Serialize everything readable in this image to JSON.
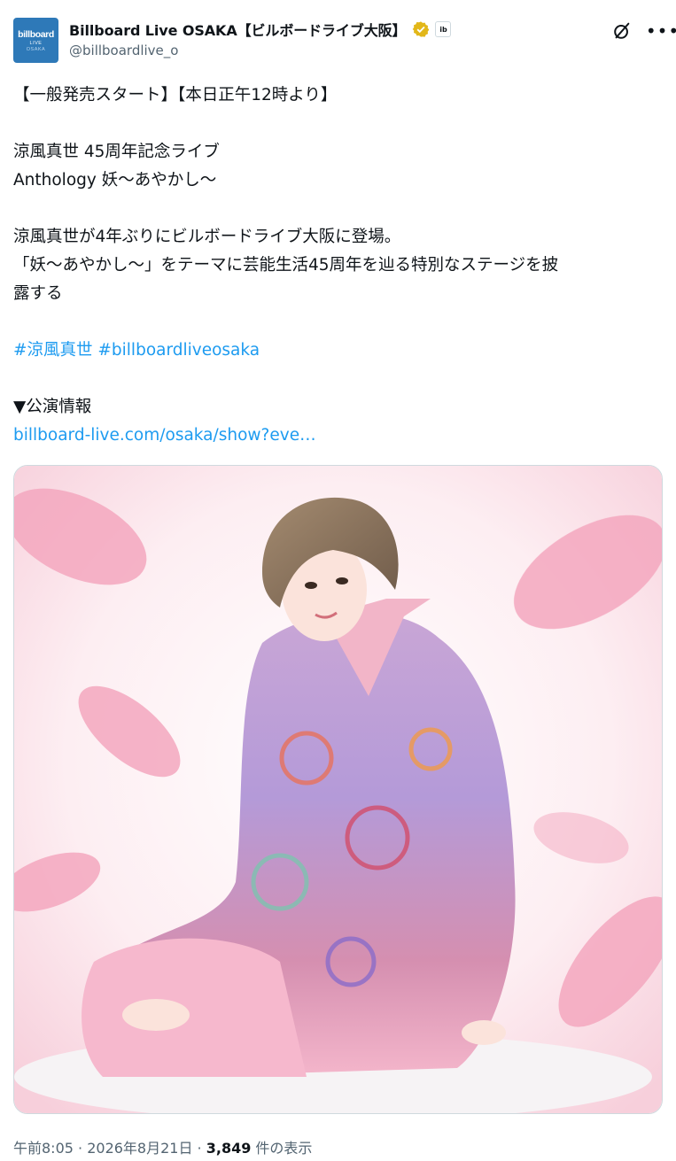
{
  "account": {
    "avatar_logo_top": "billboard",
    "avatar_logo_mid": "LIVE",
    "avatar_logo_bottom": "OSAKA",
    "display_name": "Billboard Live OSAKA【ビルボードライブ大阪】",
    "affiliate_badge": "ib",
    "handle": "@billboardlive_o"
  },
  "toolbar": {
    "grok_icon": "grok-icon",
    "more_icon": "more-options-icon"
  },
  "tweet": {
    "line1": "【一般発売スタート】【本日正午12時より】",
    "line2": "涼風真世 45周年記念ライブ",
    "line3": "Anthology 妖〜あやかし〜",
    "line4": "涼風真世が4年ぶりにビルボードライブ大阪に登場。",
    "line5": "「妖〜あやかし〜」をテーマに芸能生活45周年を辿る特別なステージを披",
    "line6": "露する",
    "hashtag1": "#涼風真世",
    "hashtag2": "#billboardliveosaka",
    "line8": "▼公演情報",
    "url": "billboard-live.com/osaka/show?eve…"
  },
  "media": {
    "description_icon": "photo-image"
  },
  "meta": {
    "time": "午前8:05",
    "sep1": " · ",
    "date": "2026年8月21日",
    "sep2": " · ",
    "views": "3,849",
    "views_label": " 件の表示"
  },
  "colors": {
    "link": "#1d9bf0",
    "verified_gold": "#e2b719",
    "secondary_text": "#536471",
    "avatar_bg": "#2e79b8"
  }
}
